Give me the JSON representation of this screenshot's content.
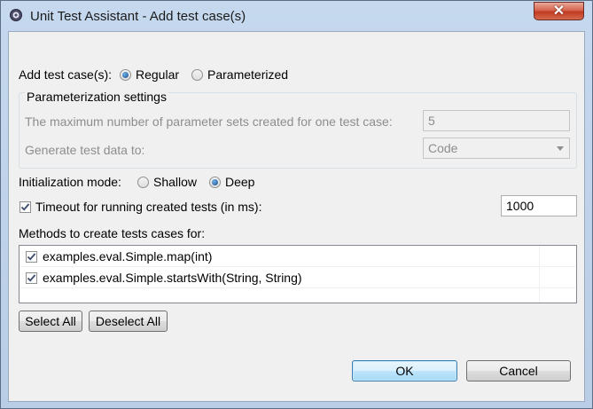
{
  "window": {
    "title": "Unit Test Assistant - Add test case(s)",
    "close_glyph": "✕"
  },
  "add_test_cases": {
    "label": "Add test case(s):",
    "options": [
      {
        "label": "Regular",
        "selected": true
      },
      {
        "label": "Parameterized",
        "selected": false
      }
    ]
  },
  "parameterization": {
    "group_title": "Parameterization settings",
    "max_sets_label": "The maximum number of parameter sets created for one test case:",
    "max_sets_value": "5",
    "generate_label": "Generate test data to:",
    "generate_value": "Code"
  },
  "initialization": {
    "label": "Initialization mode:",
    "options": [
      {
        "label": "Shallow",
        "selected": false
      },
      {
        "label": "Deep",
        "selected": true
      }
    ]
  },
  "timeout": {
    "label": "Timeout for running created tests (in ms):",
    "checked": true,
    "value": "1000"
  },
  "methods": {
    "label": "Methods to create tests cases for:",
    "items": [
      {
        "name": "examples.eval.Simple.map(int)",
        "checked": true
      },
      {
        "name": "examples.eval.Simple.startsWith(String, String)",
        "checked": true
      }
    ]
  },
  "buttons": {
    "select_all": "Select All",
    "deselect_all": "Deselect All",
    "ok": "OK",
    "cancel": "Cancel"
  },
  "colors": {
    "title_bar": "#c5d8ee",
    "dialog_bg": "#f0f0f0",
    "close_button": "#c23b21",
    "default_button": "#3c7fb1"
  }
}
